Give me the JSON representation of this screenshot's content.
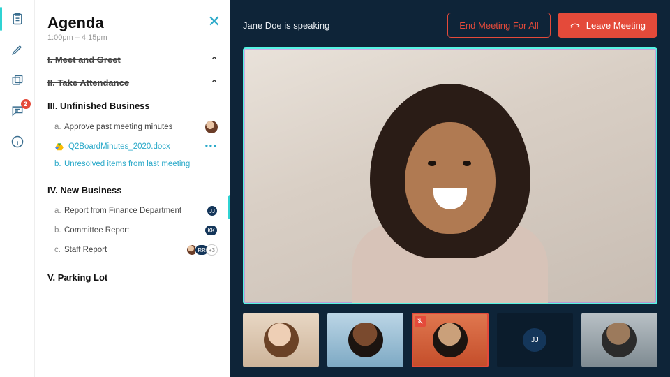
{
  "rail": {
    "icons": [
      "agenda",
      "notes",
      "docs",
      "chat",
      "info"
    ],
    "chat_badge": "2"
  },
  "agenda": {
    "title": "Agenda",
    "time": "1:00pm – 4:15pm",
    "sections": [
      {
        "label": "I. Meet and Greet",
        "done": true,
        "collapsed": true
      },
      {
        "label": "II. Take Attendance",
        "done": true,
        "collapsed": true
      },
      {
        "label": "III. Unfinished Business",
        "done": false,
        "items": [
          {
            "bullet": "a.",
            "text": "Approve past meeting minutes",
            "assignee": "avatar-img"
          },
          {
            "type": "file",
            "filename": "Q2BoardMinutes_2020.docx"
          },
          {
            "bullet": "b.",
            "text": "Unresolved items from last meeting",
            "link": true
          }
        ]
      },
      {
        "label": "IV. New Business",
        "done": false,
        "items": [
          {
            "bullet": "a.",
            "text": "Report from Finance Department",
            "assignees": [
              "JJ"
            ]
          },
          {
            "bullet": "b.",
            "text": "Committee Report",
            "assignees": [
              "KK"
            ]
          },
          {
            "bullet": "c.",
            "text": "Staff Report",
            "assignees": [
              "img",
              "RR",
              "+3"
            ]
          }
        ]
      },
      {
        "label": "V. Parking Lot",
        "done": false
      }
    ]
  },
  "stage": {
    "speaking_text": "Jane Doe is speaking",
    "end_label": "End Meeting For All",
    "leave_label": "Leave Meeting",
    "thumbs": [
      {
        "kind": "video"
      },
      {
        "kind": "video"
      },
      {
        "kind": "video",
        "muted": true
      },
      {
        "kind": "initials",
        "initials": "JJ"
      },
      {
        "kind": "video"
      }
    ]
  }
}
